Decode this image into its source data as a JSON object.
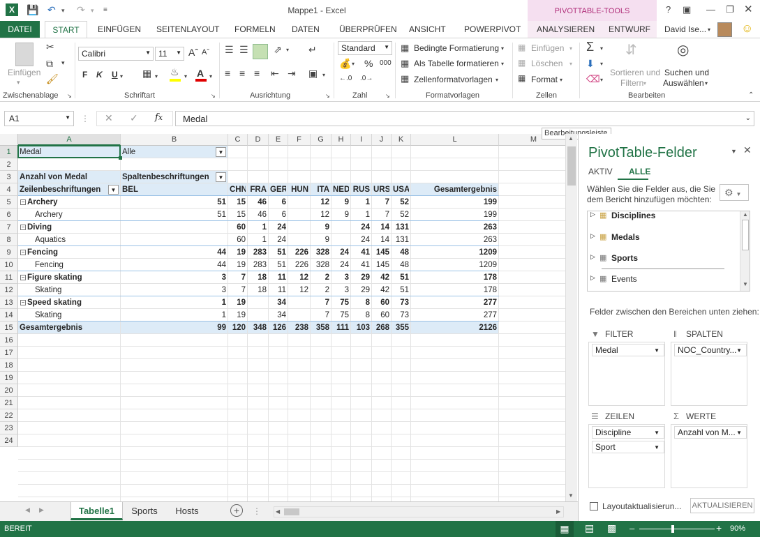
{
  "window": {
    "title": "Mappe1 - Excel",
    "context_tab_group": "PIVOTTABLE-TOOLS",
    "help": "?",
    "user": "David Ise..."
  },
  "tabs": [
    "DATEI",
    "START",
    "EINFÜGEN",
    "SEITENLAYOUT",
    "FORMELN",
    "DATEN",
    "ÜBERPRÜFEN",
    "ANSICHT",
    "POWERPIVOT",
    "ANALYSIEREN",
    "ENTWURF"
  ],
  "ribbon": {
    "clipboard": {
      "label": "Zwischenablage",
      "paste": "Einfügen"
    },
    "font": {
      "label": "Schriftart",
      "name": "Calibri",
      "size": "11",
      "bold": "F",
      "italic": "K",
      "underline": "U"
    },
    "alignment": {
      "label": "Ausrichtung"
    },
    "number": {
      "label": "Zahl",
      "format": "Standard",
      "percent": "%",
      "thousands": "000"
    },
    "styles": {
      "label": "Formatvorlagen",
      "cond": "Bedingte Formatierung",
      "table": "Als Tabelle formatieren",
      "cellstyles": "Zellenformatvorlagen"
    },
    "cells": {
      "label": "Zellen",
      "insert": "Einfügen",
      "delete": "Löschen",
      "format": "Format"
    },
    "editing": {
      "label": "Bearbeiten",
      "sort1": "Sortieren und",
      "sort2": "Filtern",
      "find1": "Suchen und",
      "find2": "Auswählen"
    }
  },
  "formula_bar": {
    "name_box": "A1",
    "content": "Medal",
    "tooltip": "Bearbeitungsleiste"
  },
  "columns": [
    "A",
    "B",
    "C",
    "D",
    "E",
    "F",
    "G",
    "H",
    "I",
    "J",
    "K",
    "L",
    "M"
  ],
  "rows": [
    "1",
    "2",
    "3",
    "4",
    "5",
    "6",
    "7",
    "8",
    "9",
    "10",
    "11",
    "12",
    "13",
    "14",
    "15",
    "16",
    "17",
    "18",
    "19",
    "20",
    "21",
    "22",
    "23",
    "24"
  ],
  "pivot": {
    "filter_label": "Medal",
    "filter_value": "Alle",
    "values_label": "Anzahl von Medal",
    "col_labels": "Spaltenbeschriftungen",
    "row_labels": "Zeilenbeschriftungen",
    "countries": [
      "BEL",
      "CHN",
      "FRA",
      "GER",
      "HUN",
      "ITA",
      "NED",
      "RUS",
      "URS",
      "USA",
      "Gesamtergebnis"
    ],
    "data_rows": [
      {
        "label": "Archery",
        "level": 0,
        "values": [
          "51",
          "15",
          "46",
          "6",
          "",
          "12",
          "9",
          "1",
          "7",
          "52",
          "199"
        ]
      },
      {
        "label": "Archery",
        "level": 1,
        "values": [
          "51",
          "15",
          "46",
          "6",
          "",
          "12",
          "9",
          "1",
          "7",
          "52",
          "199"
        ]
      },
      {
        "label": "Diving",
        "level": 0,
        "values": [
          "",
          "60",
          "1",
          "24",
          "",
          "9",
          "",
          "24",
          "14",
          "131",
          "263"
        ]
      },
      {
        "label": "Aquatics",
        "level": 1,
        "values": [
          "",
          "60",
          "1",
          "24",
          "",
          "9",
          "",
          "24",
          "14",
          "131",
          "263"
        ]
      },
      {
        "label": "Fencing",
        "level": 0,
        "values": [
          "44",
          "19",
          "283",
          "51",
          "226",
          "328",
          "24",
          "41",
          "145",
          "48",
          "1209"
        ]
      },
      {
        "label": "Fencing",
        "level": 1,
        "values": [
          "44",
          "19",
          "283",
          "51",
          "226",
          "328",
          "24",
          "41",
          "145",
          "48",
          "1209"
        ]
      },
      {
        "label": "Figure skating",
        "level": 0,
        "values": [
          "3",
          "7",
          "18",
          "11",
          "12",
          "2",
          "3",
          "29",
          "42",
          "51",
          "178"
        ]
      },
      {
        "label": "Skating",
        "level": 1,
        "values": [
          "3",
          "7",
          "18",
          "11",
          "12",
          "2",
          "3",
          "29",
          "42",
          "51",
          "178"
        ]
      },
      {
        "label": "Speed skating",
        "level": 0,
        "values": [
          "1",
          "19",
          "",
          "34",
          "",
          "7",
          "75",
          "8",
          "60",
          "73",
          "277"
        ]
      },
      {
        "label": "Skating",
        "level": 1,
        "values": [
          "1",
          "19",
          "",
          "34",
          "",
          "7",
          "75",
          "8",
          "60",
          "73",
          "277"
        ]
      }
    ],
    "total_label": "Gesamtergebnis",
    "totals": [
      "99",
      "120",
      "348",
      "126",
      "238",
      "358",
      "111",
      "103",
      "268",
      "355",
      "2126"
    ]
  },
  "sheets": [
    "Tabelle1",
    "Sports",
    "Hosts"
  ],
  "status": {
    "ready": "BEREIT",
    "zoom": "90%"
  },
  "pane": {
    "title": "PivotTable-Felder",
    "tab_active": "AKTIV",
    "tab_all": "ALLE",
    "instruction1": "Wählen Sie die Felder aus, die Sie",
    "instruction2": "dem Bericht hinzufügen möchten:",
    "fields": [
      "Disciplines",
      "Medals",
      "Sports",
      "Events"
    ],
    "drag_label": "Felder zwischen den Bereichen unten ziehen:",
    "filter": "FILTER",
    "columns": "SPALTEN",
    "rows": "ZEILEN",
    "values": "WERTE",
    "filter_items": [
      "Medal"
    ],
    "column_items": [
      "NOC_Country..."
    ],
    "row_items": [
      "Discipline",
      "Sport"
    ],
    "value_items": [
      "Anzahl von M..."
    ],
    "defer": "Layoutaktualisierun...",
    "update": "AKTUALISIEREN"
  }
}
